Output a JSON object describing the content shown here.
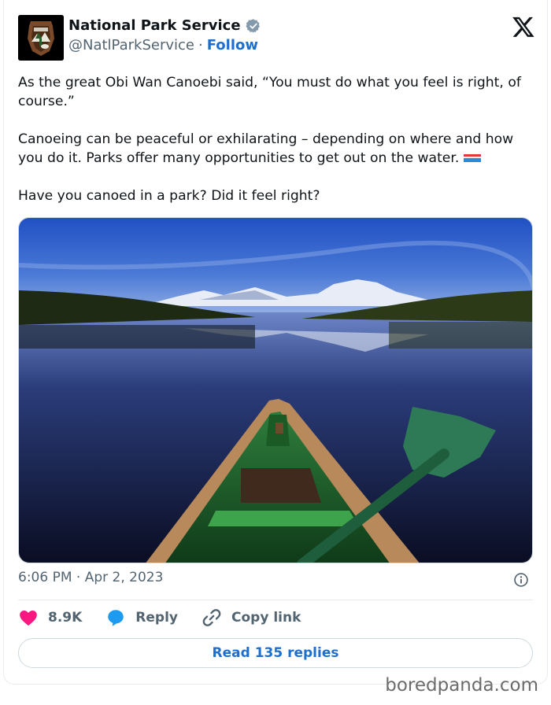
{
  "author": {
    "name": "National Park Service",
    "handle": "@NatlParkService",
    "separator": "·",
    "follow_label": "Follow",
    "avatar_icon": "nps-arrowhead-logo",
    "verified_icon": "verified-badge-icon"
  },
  "platform_icon": "x-logo",
  "tweet": {
    "paragraphs": [
      "As the great Obi Wan Canoebi said, “You must do what you feel is right, of course.”",
      "Canoeing can be peaceful or exhilarating – depending on where and how you do it. Parks offer many opportunities to get out on the water.",
      "Have you canoed in a park? Did it feel right?"
    ],
    "emoji": "canoe-emoji"
  },
  "media": {
    "description_icon": "photo-canoe-on-lake"
  },
  "timestamp": "6:06 PM · Apr 2, 2023",
  "actions": {
    "like_count": "8.9K",
    "reply_label": "Reply",
    "copy_label": "Copy link"
  },
  "read_replies_label": "Read 135 replies",
  "watermark": "boredpanda.com",
  "colors": {
    "link_blue": "#1d6fcf",
    "heart_pink": "#f91880",
    "reply_blue": "#1d9bf0",
    "muted_text": "#536471"
  }
}
